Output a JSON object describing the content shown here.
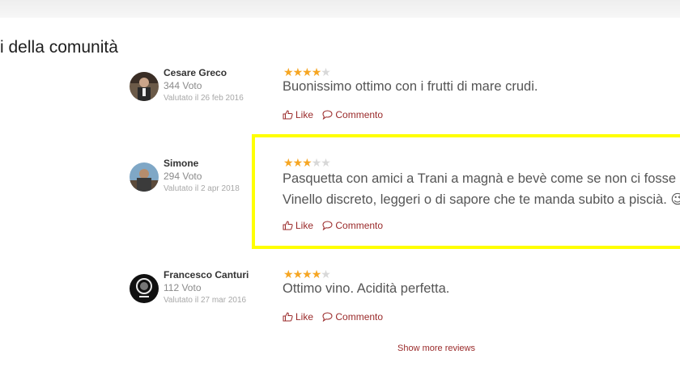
{
  "section": {
    "title": "i della comunità"
  },
  "reviews": [
    {
      "user_name": "Cesare Greco",
      "votes": "344 Voto",
      "date": "Valutato il 26 feb 2016",
      "rating": 4,
      "lines": [
        "Buonissimo ottimo con i frutti di mare crudi."
      ],
      "like_label": "Like",
      "comment_label": "Commento"
    },
    {
      "user_name": "Simone",
      "votes": "294 Voto",
      "date": "Valutato il 2 apr 2018",
      "rating": 3,
      "lines": [
        "Pasquetta con amici a Trani a magnà e bevè come se non ci fosse un",
        "Vinello discreto, leggeri o di sapore che te manda subito a piscià. 😉"
      ],
      "like_label": "Like",
      "comment_label": "Commento"
    },
    {
      "user_name": "Francesco Canturi",
      "votes": "112 Voto",
      "date": "Valutato il 27 mar 2016",
      "rating": 4,
      "lines": [
        "Ottimo vino. Acidità perfetta."
      ],
      "like_label": "Like",
      "comment_label": "Commento"
    }
  ],
  "show_more_label": "Show more reviews",
  "colors": {
    "accent": "#9a2a2a",
    "star": "#f6a623",
    "highlight": "#ffff00"
  }
}
